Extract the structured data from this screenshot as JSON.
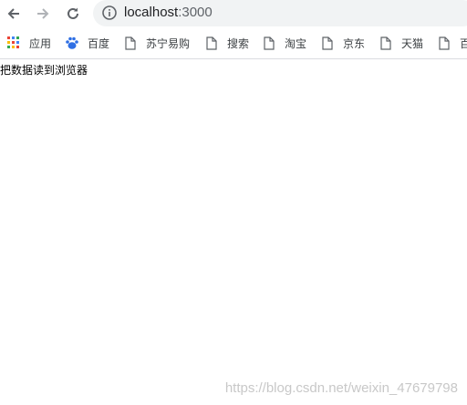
{
  "browser": {
    "url_host": "localhost",
    "url_port": ":3000",
    "bookmarks": [
      {
        "label": "应用",
        "icon": "apps-grid-icon"
      },
      {
        "label": "百度",
        "icon": "baidu-paw-icon"
      },
      {
        "label": "苏宁易购",
        "icon": "page-icon"
      },
      {
        "label": "搜索",
        "icon": "page-icon"
      },
      {
        "label": "淘宝",
        "icon": "page-icon"
      },
      {
        "label": "京东",
        "icon": "page-icon"
      },
      {
        "label": "天猫",
        "icon": "page-icon"
      },
      {
        "label": "百",
        "icon": "page-icon"
      }
    ]
  },
  "page": {
    "text": "把数据读到浏览器"
  },
  "watermark": "https://blog.csdn.net/weixin_47679798"
}
